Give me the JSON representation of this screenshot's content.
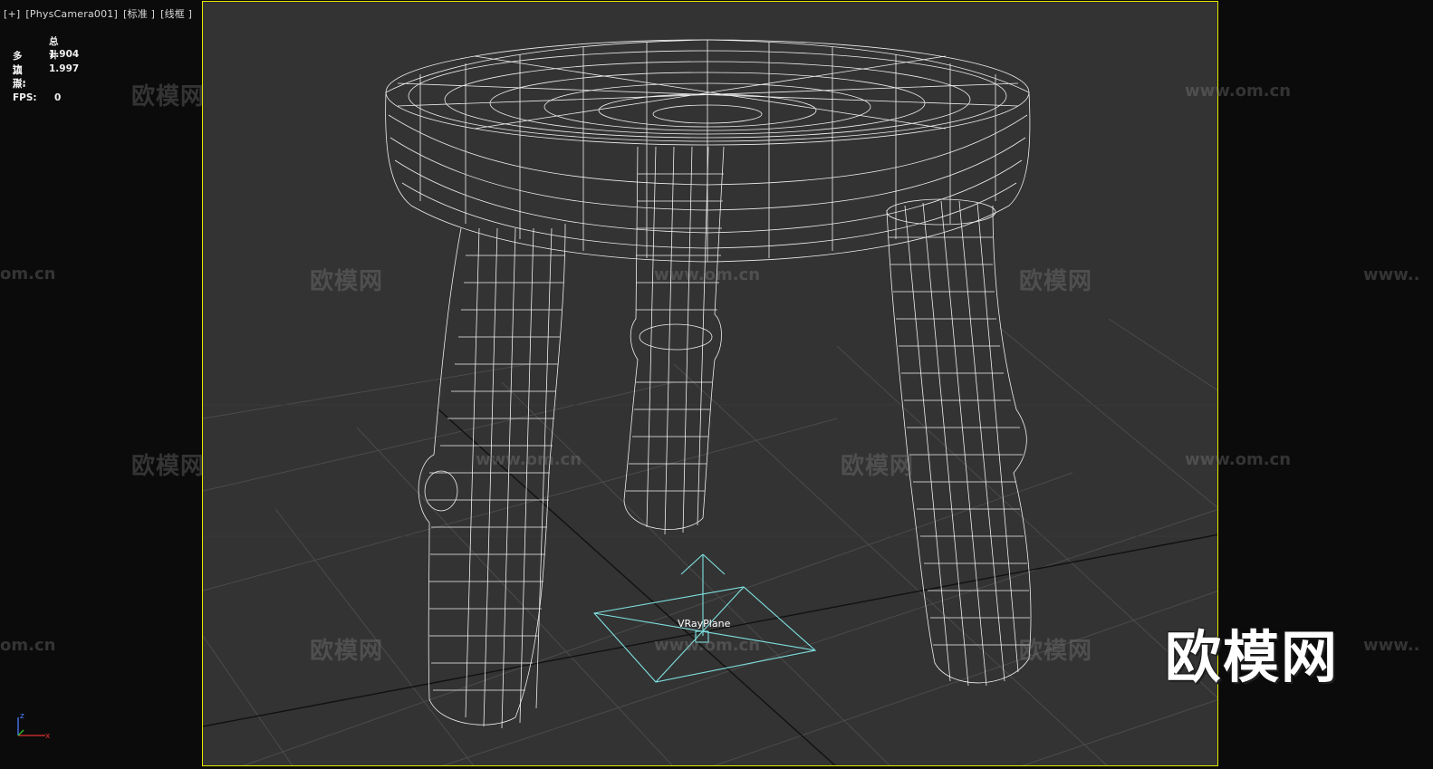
{
  "viewport": {
    "label_plus": "[+]",
    "label_camera": "[PhysCamera001]",
    "label_shading": "[标准 ]",
    "label_mode": "[线框 ]"
  },
  "stats": {
    "header": "总计",
    "polys_label": "多边形:",
    "polys_value": "1.904",
    "verts_label": "顶点:",
    "verts_value": "1.997",
    "fps_label": "FPS:",
    "fps_value": "0"
  },
  "scene": {
    "object_label": "VRayPlane",
    "frame_color": "#e6e600",
    "wire_color": "#ffffff",
    "helper_color": "#7fe0e0",
    "grid_color": "#4a4a4a",
    "background": "#333333"
  },
  "axis_tripod": {
    "z": "z",
    "x": "x"
  },
  "watermarks": {
    "cn": "欧模网",
    "url": "www.om.cn",
    "url_part": "om.cn",
    "url_start": "www.."
  },
  "logo": {
    "text": "欧模网"
  }
}
